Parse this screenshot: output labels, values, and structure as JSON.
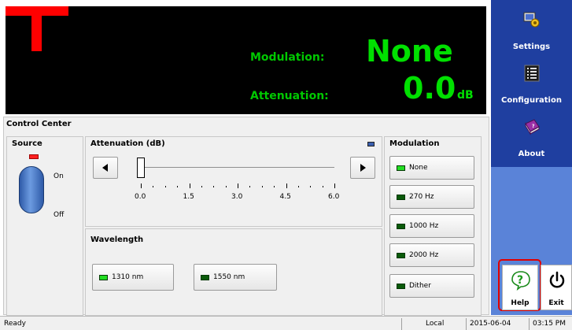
{
  "display": {
    "modulation_label": "Modulation:",
    "modulation_value": "None",
    "attenuation_label": "Attenuation:",
    "attenuation_value": "0.0",
    "attenuation_unit": "dB"
  },
  "nav": {
    "settings": "Settings",
    "configuration": "Configuration",
    "about": "About",
    "help": "Help",
    "exit": "Exit"
  },
  "control_center": {
    "title": "Control Center",
    "source": {
      "title": "Source",
      "on_label": "On",
      "off_label": "Off",
      "led_color": "#ff2020"
    },
    "attenuation": {
      "title": "Attenuation (dB)",
      "tick_labels": [
        "0.0",
        "1.5",
        "3.0",
        "4.5",
        "6.0"
      ],
      "value": 0.0,
      "min": 0.0,
      "max": 6.0
    },
    "wavelength": {
      "title": "Wavelength",
      "options": [
        {
          "label": "1310 nm",
          "selected": true
        },
        {
          "label": "1550 nm",
          "selected": false
        }
      ]
    },
    "modulation": {
      "title": "Modulation",
      "options": [
        {
          "label": "None",
          "selected": true
        },
        {
          "label": "270 Hz",
          "selected": false
        },
        {
          "label": "1000 Hz",
          "selected": false
        },
        {
          "label": "2000 Hz",
          "selected": false
        },
        {
          "label": "Dither",
          "selected": false
        }
      ]
    }
  },
  "status_bar": {
    "status": "Ready",
    "mode": "Local",
    "date": "2015-06-04",
    "time": "03:15 PM"
  },
  "colors": {
    "led_on": "#22dd22",
    "led_off": "#0a5a0a",
    "panel_dark": "#1f3fa0",
    "panel_light": "#5a83d8",
    "display_green": "#00e000",
    "help_highlight": "#e00000"
  }
}
